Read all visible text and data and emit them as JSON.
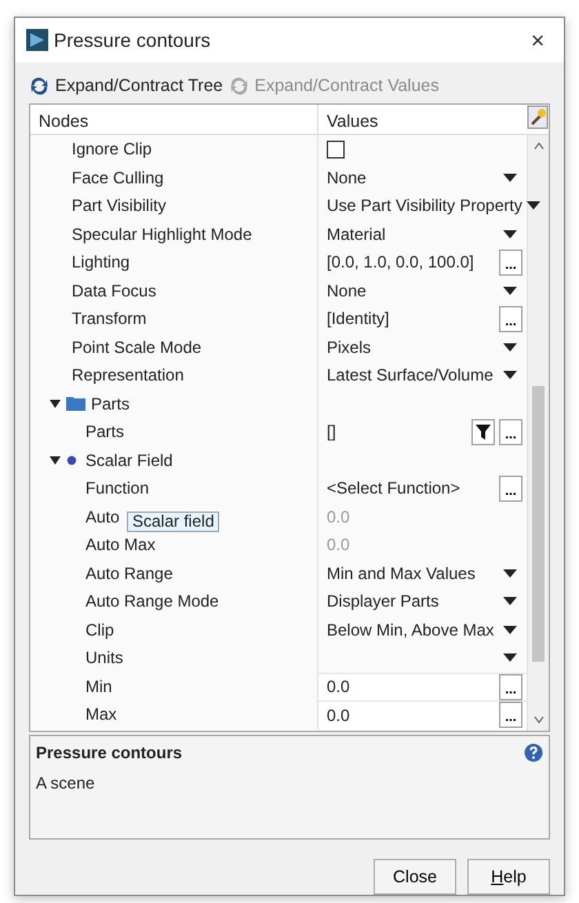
{
  "window": {
    "title": "Pressure contours",
    "close": "×"
  },
  "toolbar": [
    {
      "label": "Expand/Contract Tree",
      "disabled": false
    },
    {
      "label": "Expand/Contract Values",
      "disabled": true
    }
  ],
  "columns": [
    "Nodes",
    "Values"
  ],
  "properties": [
    {
      "label": "Ignore Clip",
      "kind": "checkbox",
      "checked": false
    },
    {
      "label": "Face Culling",
      "kind": "dropdown",
      "value": "None"
    },
    {
      "label": "Part Visibility",
      "kind": "dropdown",
      "value": "Use Part Visibility Property"
    },
    {
      "label": "Specular Highlight Mode",
      "kind": "dropdown",
      "value": "Material"
    },
    {
      "label": "Lighting",
      "kind": "dialog",
      "value": "[0.0, 1.0, 0.0, 100.0]",
      "button": "..."
    },
    {
      "label": "Data Focus",
      "kind": "dropdown",
      "value": "None"
    },
    {
      "label": "Transform",
      "kind": "dialog",
      "value": "[Identity]",
      "button": "..."
    },
    {
      "label": "Point Scale Mode",
      "kind": "dropdown",
      "value": "Pixels"
    },
    {
      "label": "Representation",
      "kind": "dropdown",
      "value": "Latest Surface/Volume"
    },
    {
      "label": "Parts",
      "kind": "folder",
      "expanded": true,
      "children": [
        {
          "label": "Parts",
          "kind": "filter",
          "value": "[]",
          "button": "..."
        }
      ]
    },
    {
      "label": "Scalar Field",
      "kind": "field",
      "expanded": true,
      "children": [
        {
          "label": "Function",
          "kind": "dialog",
          "value": "<Select Function>",
          "button": "..."
        },
        {
          "label": "Auto",
          "kind": "text",
          "value": "0.0",
          "disabled": true,
          "tooltip": "Scalar field"
        },
        {
          "label": "Auto Max",
          "kind": "text",
          "value": "0.0",
          "disabled": true
        },
        {
          "label": "Auto Range",
          "kind": "dropdown",
          "value": "Min and Max Values"
        },
        {
          "label": "Auto Range Mode",
          "kind": "dropdown",
          "value": "Displayer Parts"
        },
        {
          "label": "Clip",
          "kind": "dropdown",
          "value": "Below Min, Above Max"
        },
        {
          "label": "Units",
          "kind": "dropdown"
        },
        {
          "label": "Min",
          "kind": "dialog",
          "value": "0.0",
          "button": "...",
          "editable": true
        },
        {
          "label": "Max",
          "kind": "dialog",
          "value": "0.0",
          "button": "...",
          "editable": true
        }
      ]
    }
  ],
  "description": {
    "title": "Pressure contours",
    "text": "A scene"
  },
  "buttons": [
    {
      "label": "Close",
      "mnemonic_first": false
    },
    {
      "label": "Help",
      "mnemonic_first": true
    }
  ]
}
